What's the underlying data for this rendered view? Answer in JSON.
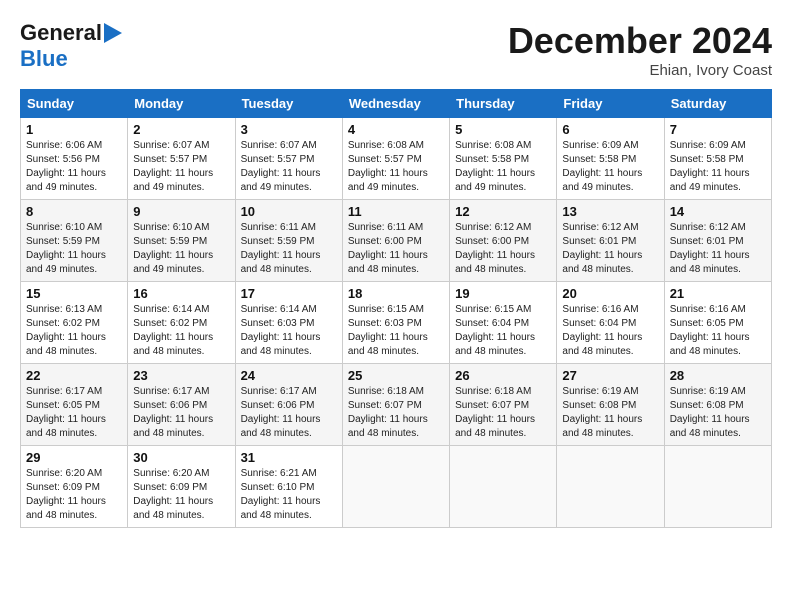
{
  "logo": {
    "line1": "General",
    "line2": "Blue"
  },
  "title": "December 2024",
  "location": "Ehian, Ivory Coast",
  "days_header": [
    "Sunday",
    "Monday",
    "Tuesday",
    "Wednesday",
    "Thursday",
    "Friday",
    "Saturday"
  ],
  "weeks": [
    [
      {
        "day": "1",
        "sunrise": "6:06 AM",
        "sunset": "5:56 PM",
        "daylight": "11 hours and 49 minutes."
      },
      {
        "day": "2",
        "sunrise": "6:07 AM",
        "sunset": "5:57 PM",
        "daylight": "11 hours and 49 minutes."
      },
      {
        "day": "3",
        "sunrise": "6:07 AM",
        "sunset": "5:57 PM",
        "daylight": "11 hours and 49 minutes."
      },
      {
        "day": "4",
        "sunrise": "6:08 AM",
        "sunset": "5:57 PM",
        "daylight": "11 hours and 49 minutes."
      },
      {
        "day": "5",
        "sunrise": "6:08 AM",
        "sunset": "5:58 PM",
        "daylight": "11 hours and 49 minutes."
      },
      {
        "day": "6",
        "sunrise": "6:09 AM",
        "sunset": "5:58 PM",
        "daylight": "11 hours and 49 minutes."
      },
      {
        "day": "7",
        "sunrise": "6:09 AM",
        "sunset": "5:58 PM",
        "daylight": "11 hours and 49 minutes."
      }
    ],
    [
      {
        "day": "8",
        "sunrise": "6:10 AM",
        "sunset": "5:59 PM",
        "daylight": "11 hours and 49 minutes."
      },
      {
        "day": "9",
        "sunrise": "6:10 AM",
        "sunset": "5:59 PM",
        "daylight": "11 hours and 49 minutes."
      },
      {
        "day": "10",
        "sunrise": "6:11 AM",
        "sunset": "5:59 PM",
        "daylight": "11 hours and 48 minutes."
      },
      {
        "day": "11",
        "sunrise": "6:11 AM",
        "sunset": "6:00 PM",
        "daylight": "11 hours and 48 minutes."
      },
      {
        "day": "12",
        "sunrise": "6:12 AM",
        "sunset": "6:00 PM",
        "daylight": "11 hours and 48 minutes."
      },
      {
        "day": "13",
        "sunrise": "6:12 AM",
        "sunset": "6:01 PM",
        "daylight": "11 hours and 48 minutes."
      },
      {
        "day": "14",
        "sunrise": "6:12 AM",
        "sunset": "6:01 PM",
        "daylight": "11 hours and 48 minutes."
      }
    ],
    [
      {
        "day": "15",
        "sunrise": "6:13 AM",
        "sunset": "6:02 PM",
        "daylight": "11 hours and 48 minutes."
      },
      {
        "day": "16",
        "sunrise": "6:14 AM",
        "sunset": "6:02 PM",
        "daylight": "11 hours and 48 minutes."
      },
      {
        "day": "17",
        "sunrise": "6:14 AM",
        "sunset": "6:03 PM",
        "daylight": "11 hours and 48 minutes."
      },
      {
        "day": "18",
        "sunrise": "6:15 AM",
        "sunset": "6:03 PM",
        "daylight": "11 hours and 48 minutes."
      },
      {
        "day": "19",
        "sunrise": "6:15 AM",
        "sunset": "6:04 PM",
        "daylight": "11 hours and 48 minutes."
      },
      {
        "day": "20",
        "sunrise": "6:16 AM",
        "sunset": "6:04 PM",
        "daylight": "11 hours and 48 minutes."
      },
      {
        "day": "21",
        "sunrise": "6:16 AM",
        "sunset": "6:05 PM",
        "daylight": "11 hours and 48 minutes."
      }
    ],
    [
      {
        "day": "22",
        "sunrise": "6:17 AM",
        "sunset": "6:05 PM",
        "daylight": "11 hours and 48 minutes."
      },
      {
        "day": "23",
        "sunrise": "6:17 AM",
        "sunset": "6:06 PM",
        "daylight": "11 hours and 48 minutes."
      },
      {
        "day": "24",
        "sunrise": "6:17 AM",
        "sunset": "6:06 PM",
        "daylight": "11 hours and 48 minutes."
      },
      {
        "day": "25",
        "sunrise": "6:18 AM",
        "sunset": "6:07 PM",
        "daylight": "11 hours and 48 minutes."
      },
      {
        "day": "26",
        "sunrise": "6:18 AM",
        "sunset": "6:07 PM",
        "daylight": "11 hours and 48 minutes."
      },
      {
        "day": "27",
        "sunrise": "6:19 AM",
        "sunset": "6:08 PM",
        "daylight": "11 hours and 48 minutes."
      },
      {
        "day": "28",
        "sunrise": "6:19 AM",
        "sunset": "6:08 PM",
        "daylight": "11 hours and 48 minutes."
      }
    ],
    [
      {
        "day": "29",
        "sunrise": "6:20 AM",
        "sunset": "6:09 PM",
        "daylight": "11 hours and 48 minutes."
      },
      {
        "day": "30",
        "sunrise": "6:20 AM",
        "sunset": "6:09 PM",
        "daylight": "11 hours and 48 minutes."
      },
      {
        "day": "31",
        "sunrise": "6:21 AM",
        "sunset": "6:10 PM",
        "daylight": "11 hours and 48 minutes."
      },
      null,
      null,
      null,
      null
    ]
  ]
}
